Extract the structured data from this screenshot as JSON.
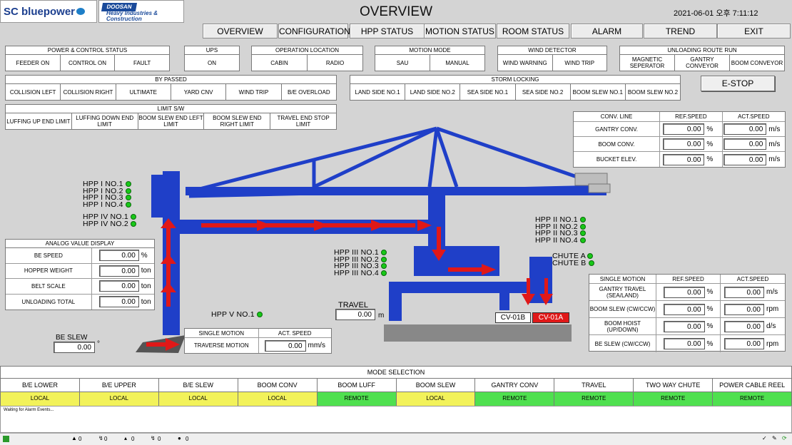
{
  "header": {
    "brand1": "SC bluepower",
    "brand2_top": "DOOSAN",
    "brand2_sub": "Heavy Industries & Construction",
    "title": "OVERVIEW",
    "datetime": "2021-06-01 오후 7:11:12"
  },
  "nav": [
    "OVERVIEW",
    "CONFIGURATION",
    "HPP STATUS",
    "MOTION STATUS",
    "ROOM STATUS",
    "ALARM",
    "TREND",
    "EXIT"
  ],
  "groups": {
    "power": {
      "title": "POWER & CONTROL STATUS",
      "items": [
        "FEEDER ON",
        "CONTROL ON",
        "FAULT"
      ]
    },
    "ups": {
      "title": "UPS",
      "items": [
        "ON"
      ]
    },
    "oploc": {
      "title": "OPERATION LOCATION",
      "items": [
        "CABIN",
        "RADIO"
      ]
    },
    "motion": {
      "title": "MOTION MODE",
      "items": [
        "SAU",
        "MANUAL"
      ]
    },
    "wind": {
      "title": "WIND DETECTOR",
      "items": [
        "WIND WARNING",
        "WIND TRIP"
      ]
    },
    "route": {
      "title": "UNLOADING ROUTE RUN",
      "items": [
        "MAGNETIC SEPERATOR",
        "GANTRY CONVEYOR",
        "BOOM CONVEYOR"
      ]
    },
    "bypass": {
      "title": "BY PASSED",
      "items": [
        "COLLISION LEFT",
        "COLLISION RIGHT",
        "ULTIMATE",
        "YARD CNV",
        "WIND TRIP",
        "B/E OVERLOAD"
      ]
    },
    "storm": {
      "title": "STORM LOCKING",
      "items": [
        "LAND SIDE NO.1",
        "LAND SIDE NO.2",
        "SEA SIDE NO.1",
        "SEA SIDE NO.2",
        "BOOM SLEW NO.1",
        "BOOM SLEW NO.2"
      ]
    },
    "limit": {
      "title": "LIMIT S/W",
      "items": [
        "LUFFING UP END LIMIT",
        "LUFFING DOWN END LIMIT",
        "BOOM SLEW END LEFT LIMIT",
        "BOOM SLEW END RIGHT LIMIT",
        "TRAVEL END STOP LIMIT"
      ]
    }
  },
  "estop": "E-STOP",
  "conv": {
    "h": [
      "CONV. LINE",
      "REF.SPEED",
      "ACT.SPEED"
    ],
    "rows": [
      {
        "n": "GANTRY CONV.",
        "r": "0.00",
        "ru": "%",
        "a": "0.00",
        "au": "m/s"
      },
      {
        "n": "BOOM CONV.",
        "r": "0.00",
        "ru": "%",
        "a": "0.00",
        "au": "m/s"
      },
      {
        "n": "BUCKET ELEV.",
        "r": "0.00",
        "ru": "%",
        "a": "0.00",
        "au": "m/s"
      }
    ]
  },
  "analog": {
    "title": "ANALOG VALUE DISPLAY",
    "rows": [
      {
        "n": "BE SPEED",
        "v": "0.00",
        "u": "%"
      },
      {
        "n": "HOPPER WEIGHT",
        "v": "0.00",
        "u": "ton"
      },
      {
        "n": "BELT SCALE",
        "v": "0.00",
        "u": "ton"
      },
      {
        "n": "UNLOADING TOTAL",
        "v": "0.00",
        "u": "ton"
      }
    ]
  },
  "single_left": {
    "h": [
      "SINGLE MOTION",
      "ACT. SPEED"
    ],
    "name": "TRAVERSE MOTION",
    "v": "0.00",
    "u": "mm/s"
  },
  "single_right": {
    "h": [
      "SINGLE MOTION",
      "REF.SPEED",
      "ACT.SPEED"
    ],
    "rows": [
      {
        "n": "GANTRY TRAVEL (SEA/LAND)",
        "r": "0.00",
        "ru": "%",
        "a": "0.00",
        "au": "m/s"
      },
      {
        "n": "BOOM SLEW (CW/CCW)",
        "r": "0.00",
        "ru": "%",
        "a": "0.00",
        "au": "rpm"
      },
      {
        "n": "BOOM HOIST (UP/DOWN)",
        "r": "0.00",
        "ru": "%",
        "a": "0.00",
        "au": "d/s"
      },
      {
        "n": "BE SLEW (CW/CCW)",
        "r": "0.00",
        "ru": "%",
        "a": "0.00",
        "au": "rpm"
      }
    ]
  },
  "hpp1": [
    "HPP I NO.1",
    "HPP I NO.2",
    "HPP I NO.3",
    "HPP I NO.4"
  ],
  "hpp4": [
    "HPP IV NO.1",
    "HPP IV NO.2"
  ],
  "hpp2": [
    "HPP II NO.1",
    "HPP II NO.2",
    "HPP II NO.3",
    "HPP II NO.4"
  ],
  "hpp3": [
    "HPP III NO.1",
    "HPP III NO.2",
    "HPP III NO.3",
    "HPP III NO.4"
  ],
  "chute": [
    "CHUTE A",
    "CHUTE B"
  ],
  "hpp5": "HPP V NO.1",
  "travel": {
    "label": "TRAVEL",
    "v": "0.00",
    "u": "m"
  },
  "beslew": {
    "label": "BE SLEW",
    "v": "0.00",
    "u": "°"
  },
  "cv": {
    "b": "CV-01B",
    "a": "CV-01A"
  },
  "modesel": {
    "title": "MODE SELECTION",
    "names": [
      "B/E LOWER",
      "B/E UPPER",
      "B/E SLEW",
      "BOOM CONV",
      "BOOM LUFF",
      "BOOM SLEW",
      "GANTRY CONV",
      "TRAVEL",
      "TWO WAY CHUTE",
      "POWER CABLE REEL"
    ],
    "states": [
      "LOCAL",
      "LOCAL",
      "LOCAL",
      "LOCAL",
      "REMOTE",
      "LOCAL",
      "REMOTE",
      "REMOTE",
      "REMOTE",
      "REMOTE"
    ]
  },
  "alarm": {
    "text": "Waiting for Alarm Events..."
  },
  "statusbar": [
    "0",
    "0",
    "0",
    "0",
    "0"
  ],
  "colors": {
    "local": "#f2f25a",
    "remote": "#4fe04f",
    "crane": "#1f3fc8",
    "arrow": "#e01818",
    "cv_a": "#e01818"
  }
}
